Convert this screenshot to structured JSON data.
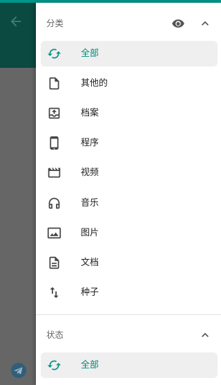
{
  "colors": {
    "accent": "#009688",
    "header": "#0b4a41",
    "scrim": "#666666",
    "selected_bg": "#efefef",
    "selected_text": "#00897b"
  },
  "background": {
    "back_icon": "arrow-left-icon",
    "fab_icon": "telegram-icon"
  },
  "categories": {
    "title": "分类",
    "visibility_icon": "eye-icon",
    "collapse_icon": "chevron-up-icon",
    "items": [
      {
        "label": "全部",
        "icon": "refresh-icon",
        "selected": true
      },
      {
        "label": "其他的",
        "icon": "file-icon",
        "selected": false
      },
      {
        "label": "档案",
        "icon": "archive-icon",
        "selected": false
      },
      {
        "label": "程序",
        "icon": "phone-icon",
        "selected": false
      },
      {
        "label": "视频",
        "icon": "clapperboard-icon",
        "selected": false
      },
      {
        "label": "音乐",
        "icon": "headphones-icon",
        "selected": false
      },
      {
        "label": "图片",
        "icon": "image-icon",
        "selected": false
      },
      {
        "label": "文档",
        "icon": "document-icon",
        "selected": false
      },
      {
        "label": "种子",
        "icon": "swap-vertical-icon",
        "selected": false
      }
    ]
  },
  "status": {
    "title": "状态",
    "collapse_icon": "chevron-up-icon",
    "items": [
      {
        "label": "全部",
        "icon": "refresh-icon",
        "selected": true
      }
    ]
  }
}
